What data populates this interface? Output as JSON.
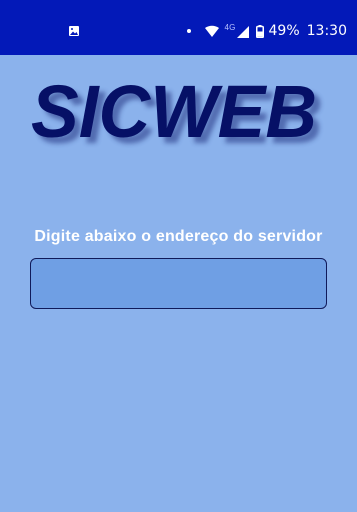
{
  "status_bar": {
    "notification_icon": "image-icon",
    "dot_icon": "notification-dot-icon",
    "wifi_icon": "wifi-icon",
    "network_type": "4G",
    "signal_icon": "signal-icon",
    "battery_icon": "battery-icon",
    "battery_percent": "49%",
    "time": "13:30",
    "background_color": "#0319b8"
  },
  "logo": {
    "text": "SICWEB",
    "fill_color": "#061066",
    "shadow_color": "#203080"
  },
  "content": {
    "prompt": "Digite abaixo o endereço do servidor",
    "input": {
      "value": "",
      "placeholder": ""
    }
  },
  "colors": {
    "background": "#8bb2ec",
    "input_background": "#6f9fe4",
    "input_border": "#101a5a",
    "text": "#ffffff"
  }
}
